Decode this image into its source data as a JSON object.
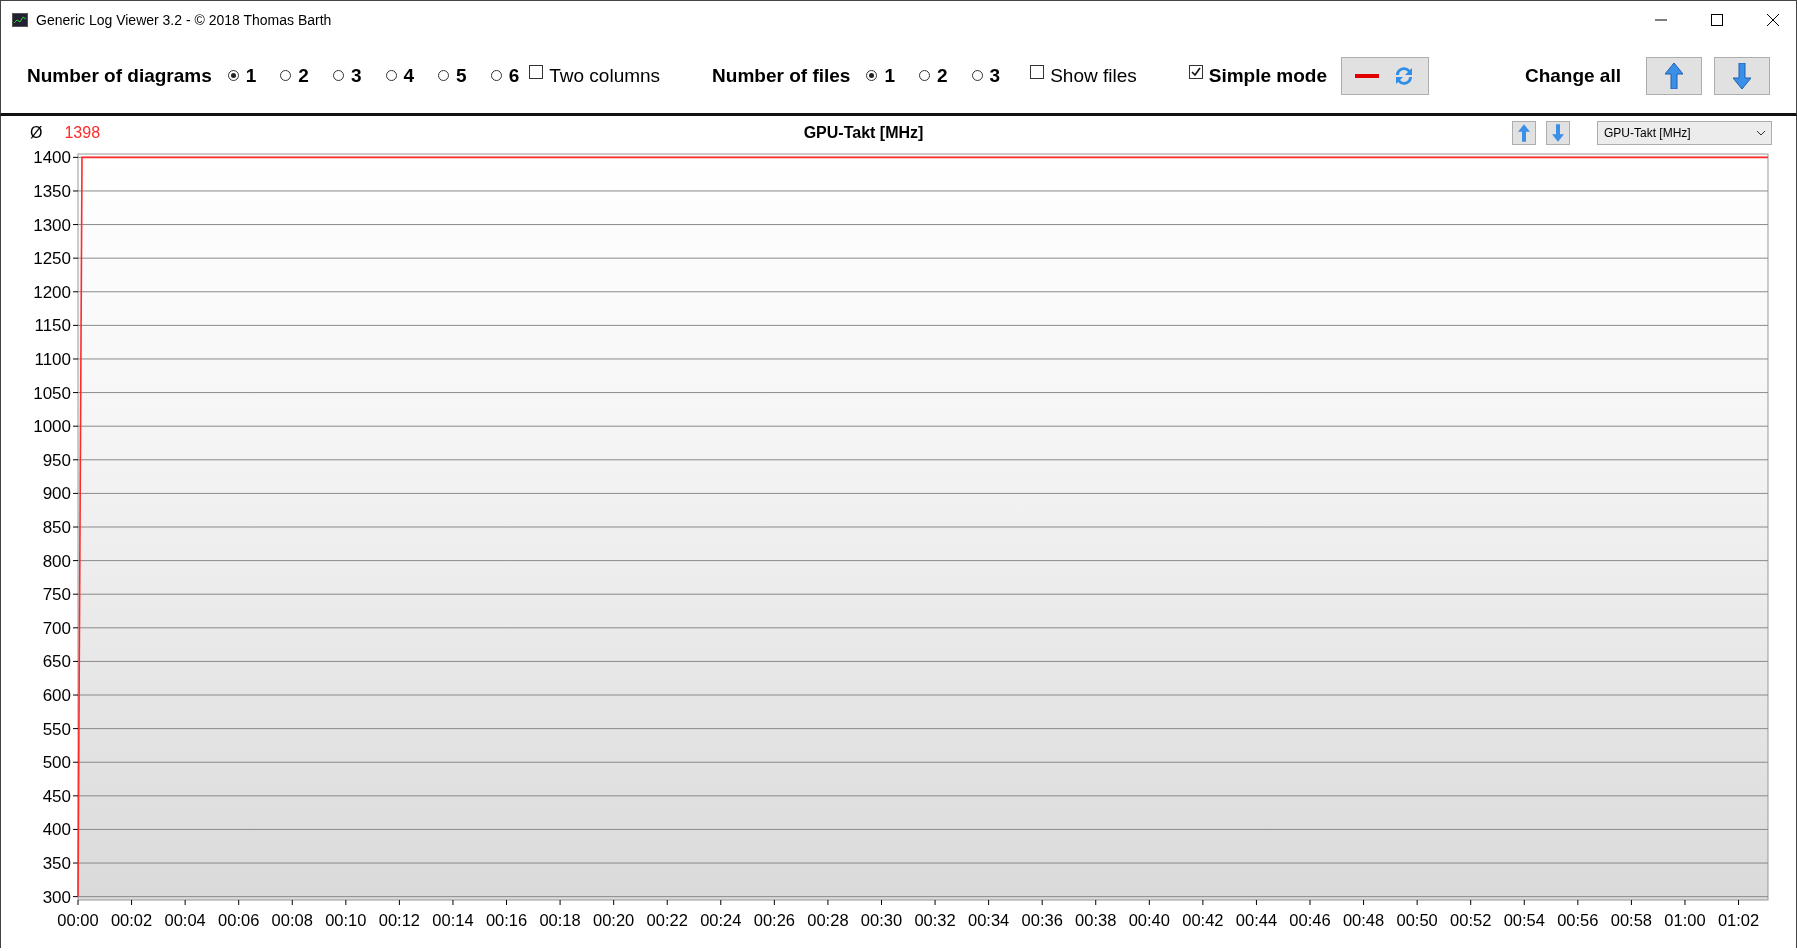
{
  "window": {
    "title": "Generic Log Viewer 3.2 - © 2018 Thomas Barth"
  },
  "toolbar": {
    "diagrams": {
      "label": "Number of diagrams",
      "options": [
        {
          "label": "1",
          "selected": true
        },
        {
          "label": "2",
          "selected": false
        },
        {
          "label": "3",
          "selected": false
        },
        {
          "label": "4",
          "selected": false
        },
        {
          "label": "5",
          "selected": false
        },
        {
          "label": "6",
          "selected": false
        }
      ]
    },
    "two_columns": {
      "label": "Two columns",
      "checked": false
    },
    "files": {
      "label": "Number of files",
      "options": [
        {
          "label": "1",
          "selected": true
        },
        {
          "label": "2",
          "selected": false
        },
        {
          "label": "3",
          "selected": false
        }
      ]
    },
    "show_files": {
      "label": "Show files",
      "checked": false
    },
    "simple_mode": {
      "label": "Simple mode",
      "checked": true
    },
    "change_all": {
      "label": "Change all"
    }
  },
  "diagram": {
    "average_symbol": "Ø",
    "average": "1398",
    "title": "GPU-Takt [MHz]",
    "selector": {
      "value": "GPU-Takt [MHz]"
    },
    "chart_data": {
      "type": "line",
      "x": [
        0,
        0.15,
        63.1
      ],
      "series": [
        {
          "color": "#ff2a2a",
          "values": [
            300,
            1400,
            1400
          ]
        }
      ],
      "grid": true,
      "xlim": [
        0,
        63.1
      ],
      "ylim": [
        295,
        1405
      ],
      "yticks": [
        300,
        350,
        400,
        450,
        500,
        550,
        600,
        650,
        700,
        750,
        800,
        850,
        900,
        950,
        1000,
        1050,
        1100,
        1150,
        1200,
        1250,
        1300,
        1350,
        1400
      ],
      "xticks": [
        {
          "value": 0,
          "label": "00:00"
        },
        {
          "value": 2,
          "label": "00:02"
        },
        {
          "value": 4,
          "label": "00:04"
        },
        {
          "value": 6,
          "label": "00:06"
        },
        {
          "value": 8,
          "label": "00:08"
        },
        {
          "value": 10,
          "label": "00:10"
        },
        {
          "value": 12,
          "label": "00:12"
        },
        {
          "value": 14,
          "label": "00:14"
        },
        {
          "value": 16,
          "label": "00:16"
        },
        {
          "value": 18,
          "label": "00:18"
        },
        {
          "value": 20,
          "label": "00:20"
        },
        {
          "value": 22,
          "label": "00:22"
        },
        {
          "value": 24,
          "label": "00:24"
        },
        {
          "value": 26,
          "label": "00:26"
        },
        {
          "value": 28,
          "label": "00:28"
        },
        {
          "value": 30,
          "label": "00:30"
        },
        {
          "value": 32,
          "label": "00:32"
        },
        {
          "value": 34,
          "label": "00:34"
        },
        {
          "value": 36,
          "label": "00:36"
        },
        {
          "value": 38,
          "label": "00:38"
        },
        {
          "value": 40,
          "label": "00:40"
        },
        {
          "value": 42,
          "label": "00:42"
        },
        {
          "value": 44,
          "label": "00:44"
        },
        {
          "value": 46,
          "label": "00:46"
        },
        {
          "value": 48,
          "label": "00:48"
        },
        {
          "value": 50,
          "label": "00:50"
        },
        {
          "value": 52,
          "label": "00:52"
        },
        {
          "value": 54,
          "label": "00:54"
        },
        {
          "value": 56,
          "label": "00:56"
        },
        {
          "value": 58,
          "label": "00:58"
        },
        {
          "value": 60,
          "label": "01:00"
        },
        {
          "value": 62,
          "label": "01:02"
        }
      ]
    }
  }
}
